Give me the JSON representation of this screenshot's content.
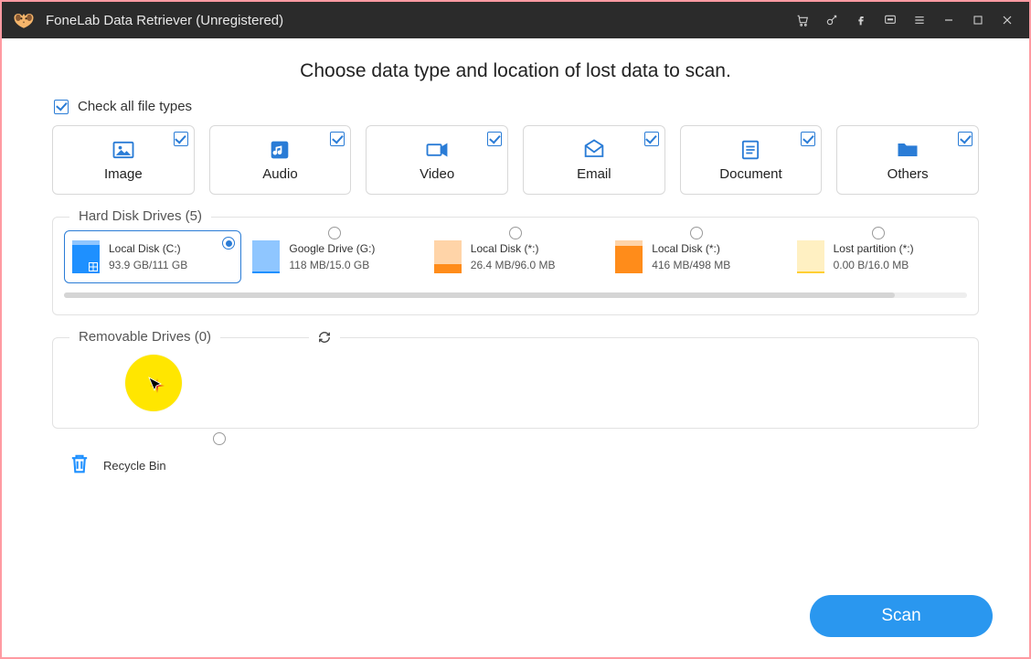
{
  "app": {
    "title": "FoneLab Data Retriever (Unregistered)"
  },
  "headline": "Choose data type and location of lost data to scan.",
  "check_all_label": "Check all file types",
  "types": [
    {
      "label": "Image"
    },
    {
      "label": "Audio"
    },
    {
      "label": "Video"
    },
    {
      "label": "Email"
    },
    {
      "label": "Document"
    },
    {
      "label": "Others"
    }
  ],
  "hdd": {
    "legend": "Hard Disk Drives (5)",
    "drives": [
      {
        "name": "Local Disk (C:)",
        "size": "93.9 GB/111 GB",
        "used_pct": 85,
        "palette": "blue",
        "win": true,
        "selected": true
      },
      {
        "name": "Google Drive (G:)",
        "size": "118 MB/15.0 GB",
        "used_pct": 2,
        "palette": "blue",
        "win": false,
        "selected": false
      },
      {
        "name": "Local Disk (*:)",
        "size": "26.4 MB/96.0 MB",
        "used_pct": 28,
        "palette": "orange",
        "win": false,
        "selected": false
      },
      {
        "name": "Local Disk (*:)",
        "size": "416 MB/498 MB",
        "used_pct": 84,
        "palette": "orange",
        "win": false,
        "selected": false
      },
      {
        "name": "Lost partition (*:)",
        "size": "0.00  B/16.0 MB",
        "used_pct": 0,
        "palette": "yellow",
        "win": false,
        "selected": false
      }
    ]
  },
  "removable": {
    "legend": "Removable Drives (0)"
  },
  "recycle": {
    "label": "Recycle Bin"
  },
  "scan_label": "Scan"
}
